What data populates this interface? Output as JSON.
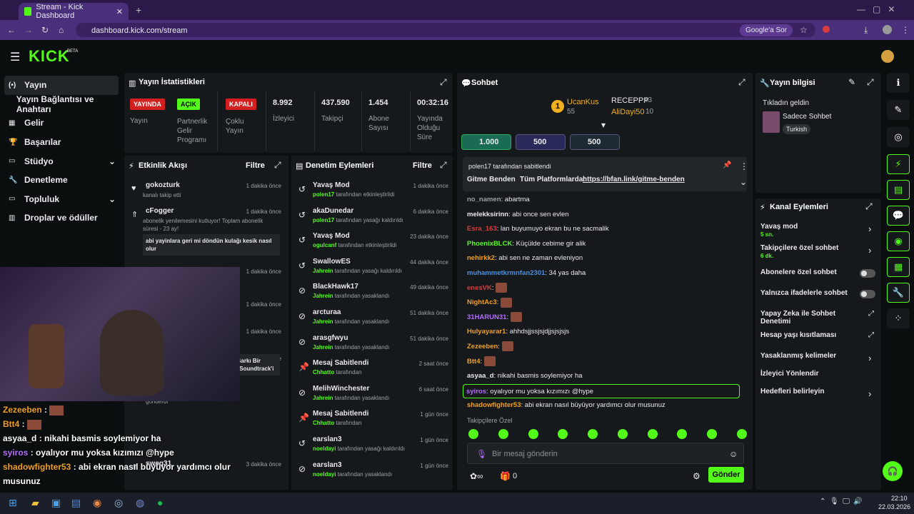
{
  "browser": {
    "tab_title": "Stream - Kick Dashboard",
    "url": "dashboard.kick.com/stream",
    "google_btn": "Google'a Sor",
    "new_tab": "+"
  },
  "app": {
    "logo": "KICK",
    "beta": "BETA"
  },
  "nav": [
    {
      "label": "Yayın",
      "icon": "(•)"
    },
    {
      "label": "Yayın Bağlantısı ve Anahtarı",
      "icon": ""
    },
    {
      "label": "Gelir",
      "icon": "▦"
    },
    {
      "label": "Başarılar",
      "icon": "🏆"
    },
    {
      "label": "Stüdyo",
      "icon": "▭"
    },
    {
      "label": "Denetleme",
      "icon": "🔧"
    },
    {
      "label": "Topluluk",
      "icon": "▭"
    },
    {
      "label": "Droplar ve ödüller",
      "icon": "▥"
    }
  ],
  "stats": {
    "title": "Yayın İstatistikleri",
    "badges": [
      "YAYINDA",
      "AÇIK",
      "KAPALI"
    ],
    "badge_labels": [
      "Yayın",
      "Partnerlik Gelir Programı",
      "Çoklu Yayın"
    ],
    "values": [
      {
        "v": "8.992",
        "l": "İzleyici"
      },
      {
        "v": "437.590",
        "l": "Takipçi"
      },
      {
        "v": "1.454",
        "l": "Abone Sayısı"
      },
      {
        "v": "00:32:16",
        "l": "Yayında Olduğu Süre"
      }
    ]
  },
  "activity": {
    "title": "Etkinlik Akışı",
    "filter": "Filtre",
    "items": [
      {
        "user": "gokozturk",
        "desc": "kanalı takip etti",
        "time": "1 dakika önce"
      },
      {
        "user": "cFogger",
        "desc": "abonelik yenilemesini kutluyor! Toplam abonelik süresi - 23 ay!",
        "time": "1 dakika önce",
        "msg": "abi yayinlara geri mi döndün kulağı kesik nasıl olur"
      },
      {
        "user": "",
        "desc": "",
        "time": "1 dakika önce"
      },
      {
        "user": "",
        "desc": "lam abonelik",
        "time": "1 dakika önce"
      },
      {
        "user": "",
        "desc": "",
        "time": "1 dakika önce"
      },
      {
        "user": "",
        "desc": "",
        "time": "949 hafta önce",
        "msg": "3 adet önerim var benimde ya Bir Şarkı Bir Hayat, Ritmin Anatomisi, Zamanın Soundtrack'i",
        "amount": "1.000",
        "sent": "gönderdi"
      },
      {
        "user": "sweq31",
        "desc": "",
        "time": "3 dakika önce"
      }
    ]
  },
  "moderation": {
    "title": "Denetim Eylemleri",
    "filter": "Filtre",
    "items": [
      {
        "title": "Yavaş Mod",
        "actor": "polen17",
        "action": "tarafından etkinleştirildi",
        "time": "1 dakika önce"
      },
      {
        "title": "akaDunedar",
        "actor": "polen17",
        "action": "tarafından yasağı kaldırıldı",
        "time": "6 dakika önce"
      },
      {
        "title": "Yavaş Mod",
        "actor": "ogulcanf",
        "action": "tarafından etkinleştirildi",
        "time": "23 dakika önce"
      },
      {
        "title": "SwallowES",
        "actor": "Jahrein",
        "action": "tarafından yasağı kaldırıldı",
        "time": "44 dakika önce"
      },
      {
        "title": "BlackHawk17",
        "actor": "Jahrein",
        "action": "tarafından yasaklandı",
        "time": "49 dakika önce"
      },
      {
        "title": "arcturaa",
        "actor": "Jahrein",
        "action": "tarafından yasaklandı",
        "time": "51 dakika önce"
      },
      {
        "title": "arasgfwyu",
        "actor": "Jahrein",
        "action": "tarafından yasaklandı",
        "time": "51 dakika önce"
      },
      {
        "title": "Mesaj Sabitlendi",
        "actor": "Chhatto",
        "action": "tarafından",
        "time": "2 saat önce"
      },
      {
        "title": "MelihWinchester",
        "actor": "Jahrein",
        "action": "tarafından yasaklandı",
        "time": "6 saat önce"
      },
      {
        "title": "Mesaj Sabitlendi",
        "actor": "Chhatto",
        "action": "tarafından",
        "time": "1 gün önce"
      },
      {
        "title": "earslan3",
        "actor": "noeldayi",
        "action": "tarafından yasağı kaldırıldı",
        "time": "1 gün önce"
      },
      {
        "title": "earslan3",
        "actor": "noeldayi",
        "action": "tarafından yasaklandı",
        "time": "1 gün önce"
      }
    ]
  },
  "chat": {
    "title": "Sohbet",
    "top": [
      {
        "name": "UcanKus",
        "value": "55",
        "rank": "1"
      },
      {
        "name": "RECEPPP",
        "value": "43"
      },
      {
        "name": "AliDayi50",
        "value": "10"
      }
    ],
    "goals": [
      "1.000",
      "500",
      "500"
    ],
    "pinned": {
      "by": "polen17 tarafından sabitlendi",
      "user": "Gitme Benden",
      "text": "Tüm Platformlarda:",
      "link": "https://bfan.link/gitme-benden"
    },
    "messages": [
      {
        "user": "no_namen",
        "color": "#9aa0a6",
        "text": "abartma"
      },
      {
        "user": "melekksirinn",
        "color": "#e8eaed",
        "text": "abi once sen evlen"
      },
      {
        "user": "Esra_163",
        "color": "#d93c3c",
        "text": "lan buyumuyo ekran bu ne sacmalik"
      },
      {
        "user": "PhoenixBLCK",
        "color": "#53fc18",
        "text": "Küçülde cebime gir alik"
      },
      {
        "user": "nehirkk2",
        "color": "#f0a020",
        "text": "abi sen ne zaman evleniyon"
      },
      {
        "user": "muhammetkrmnfan2301",
        "color": "#4a90e2",
        "text": "34 yas daha"
      },
      {
        "user": "enesVK",
        "color": "#d93c3c",
        "text": ""
      },
      {
        "user": "NightAc3",
        "color": "#f0a020",
        "text": ""
      },
      {
        "user": "31HARUN31",
        "color": "#b46cff",
        "text": ""
      },
      {
        "user": "Hulyayarar1",
        "color": "#f0a020",
        "text": "ahhdsjjssjsjdjjsjsjsjs"
      },
      {
        "user": "Zezeeben",
        "color": "#f0a020",
        "text": ""
      },
      {
        "user": "Btt4",
        "color": "#f0a020",
        "text": ""
      },
      {
        "user": "asyaa_d",
        "color": "#e8eaed",
        "text": "nikahi basmis soylemiyor ha"
      },
      {
        "user": "syiros",
        "color": "#b46cff",
        "text": "oyalıyor mu yoksa kızımızı @hype"
      },
      {
        "user": "shadowfighter53",
        "color": "#f0a020",
        "text": "abi ekran nasıl büyüyor yardımcı olur musunuz"
      }
    ],
    "emote_label": "Takipçilere Özel",
    "placeholder": "Bir mesaj gönderin",
    "send": "Gönder",
    "count": "0"
  },
  "info": {
    "title": "Yayın bilgisi",
    "stream_title": "Tıkladın geldin",
    "category": "Sadece Sohbet",
    "tag": "Turkish"
  },
  "actions": {
    "title": "Kanal Eylemleri",
    "items": [
      {
        "label": "Yavaş mod",
        "sub": "5 sn.",
        "type": "chevron"
      },
      {
        "label": "Takipçilere özel sohbet",
        "sub": "6 dk.",
        "type": "chevron"
      },
      {
        "label": "Abonelere özel sohbet",
        "sub": "",
        "type": "toggle"
      },
      {
        "label": "Yalnızca ifadelerle sohbet",
        "sub": "",
        "type": "toggle"
      },
      {
        "label": "Yapay Zeka ile Sohbet Denetimi",
        "sub": "",
        "type": "ext"
      },
      {
        "label": "Hesap yaşı kısıtlaması",
        "sub": "",
        "type": "ext"
      },
      {
        "label": "Yasaklanmış kelimeler",
        "sub": "",
        "type": "chevron"
      },
      {
        "label": "İzleyici Yönlendir",
        "sub": "",
        "type": "none"
      },
      {
        "label": "Hedefleri belirleyin",
        "sub": "",
        "type": "chevron"
      }
    ]
  },
  "overlay": [
    {
      "user": "Zezeeben",
      "color": "#f0a020",
      "text": ""
    },
    {
      "user": "Btt4",
      "color": "#f0a020",
      "text": ""
    },
    {
      "user": "asyaa_d",
      "color": "#ffffff",
      "text": "nikahi basmis soylemiyor ha"
    },
    {
      "user": "syiros",
      "color": "#b46cff",
      "text": "oyalıyor mu yoksa kızımızı @hype"
    },
    {
      "user": "shadowfighter53",
      "color": "#f0a020",
      "text": "abi ekran nasıl büyüyor yardımcı olur musunuz"
    }
  ],
  "taskbar": {
    "time": "22:10",
    "date": "22.03.2026"
  }
}
